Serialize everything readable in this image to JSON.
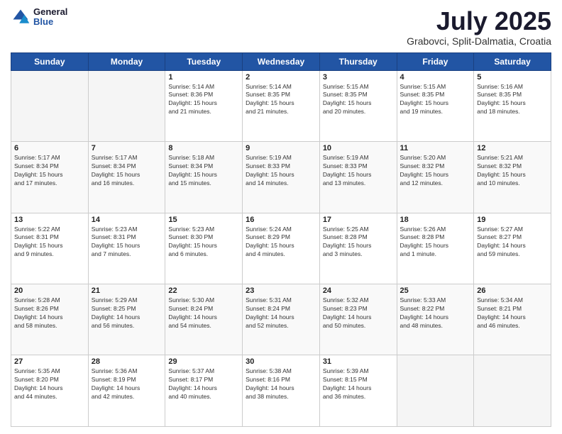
{
  "header": {
    "logo": {
      "general": "General",
      "blue": "Blue"
    },
    "title": "July 2025",
    "location": "Grabovci, Split-Dalmatia, Croatia"
  },
  "weekdays": [
    "Sunday",
    "Monday",
    "Tuesday",
    "Wednesday",
    "Thursday",
    "Friday",
    "Saturday"
  ],
  "weeks": [
    [
      {
        "day": "",
        "info": ""
      },
      {
        "day": "",
        "info": ""
      },
      {
        "day": "1",
        "info": "Sunrise: 5:14 AM\nSunset: 8:36 PM\nDaylight: 15 hours\nand 21 minutes."
      },
      {
        "day": "2",
        "info": "Sunrise: 5:14 AM\nSunset: 8:35 PM\nDaylight: 15 hours\nand 21 minutes."
      },
      {
        "day": "3",
        "info": "Sunrise: 5:15 AM\nSunset: 8:35 PM\nDaylight: 15 hours\nand 20 minutes."
      },
      {
        "day": "4",
        "info": "Sunrise: 5:15 AM\nSunset: 8:35 PM\nDaylight: 15 hours\nand 19 minutes."
      },
      {
        "day": "5",
        "info": "Sunrise: 5:16 AM\nSunset: 8:35 PM\nDaylight: 15 hours\nand 18 minutes."
      }
    ],
    [
      {
        "day": "6",
        "info": "Sunrise: 5:17 AM\nSunset: 8:34 PM\nDaylight: 15 hours\nand 17 minutes."
      },
      {
        "day": "7",
        "info": "Sunrise: 5:17 AM\nSunset: 8:34 PM\nDaylight: 15 hours\nand 16 minutes."
      },
      {
        "day": "8",
        "info": "Sunrise: 5:18 AM\nSunset: 8:34 PM\nDaylight: 15 hours\nand 15 minutes."
      },
      {
        "day": "9",
        "info": "Sunrise: 5:19 AM\nSunset: 8:33 PM\nDaylight: 15 hours\nand 14 minutes."
      },
      {
        "day": "10",
        "info": "Sunrise: 5:19 AM\nSunset: 8:33 PM\nDaylight: 15 hours\nand 13 minutes."
      },
      {
        "day": "11",
        "info": "Sunrise: 5:20 AM\nSunset: 8:32 PM\nDaylight: 15 hours\nand 12 minutes."
      },
      {
        "day": "12",
        "info": "Sunrise: 5:21 AM\nSunset: 8:32 PM\nDaylight: 15 hours\nand 10 minutes."
      }
    ],
    [
      {
        "day": "13",
        "info": "Sunrise: 5:22 AM\nSunset: 8:31 PM\nDaylight: 15 hours\nand 9 minutes."
      },
      {
        "day": "14",
        "info": "Sunrise: 5:23 AM\nSunset: 8:31 PM\nDaylight: 15 hours\nand 7 minutes."
      },
      {
        "day": "15",
        "info": "Sunrise: 5:23 AM\nSunset: 8:30 PM\nDaylight: 15 hours\nand 6 minutes."
      },
      {
        "day": "16",
        "info": "Sunrise: 5:24 AM\nSunset: 8:29 PM\nDaylight: 15 hours\nand 4 minutes."
      },
      {
        "day": "17",
        "info": "Sunrise: 5:25 AM\nSunset: 8:28 PM\nDaylight: 15 hours\nand 3 minutes."
      },
      {
        "day": "18",
        "info": "Sunrise: 5:26 AM\nSunset: 8:28 PM\nDaylight: 15 hours\nand 1 minute."
      },
      {
        "day": "19",
        "info": "Sunrise: 5:27 AM\nSunset: 8:27 PM\nDaylight: 14 hours\nand 59 minutes."
      }
    ],
    [
      {
        "day": "20",
        "info": "Sunrise: 5:28 AM\nSunset: 8:26 PM\nDaylight: 14 hours\nand 58 minutes."
      },
      {
        "day": "21",
        "info": "Sunrise: 5:29 AM\nSunset: 8:25 PM\nDaylight: 14 hours\nand 56 minutes."
      },
      {
        "day": "22",
        "info": "Sunrise: 5:30 AM\nSunset: 8:24 PM\nDaylight: 14 hours\nand 54 minutes."
      },
      {
        "day": "23",
        "info": "Sunrise: 5:31 AM\nSunset: 8:24 PM\nDaylight: 14 hours\nand 52 minutes."
      },
      {
        "day": "24",
        "info": "Sunrise: 5:32 AM\nSunset: 8:23 PM\nDaylight: 14 hours\nand 50 minutes."
      },
      {
        "day": "25",
        "info": "Sunrise: 5:33 AM\nSunset: 8:22 PM\nDaylight: 14 hours\nand 48 minutes."
      },
      {
        "day": "26",
        "info": "Sunrise: 5:34 AM\nSunset: 8:21 PM\nDaylight: 14 hours\nand 46 minutes."
      }
    ],
    [
      {
        "day": "27",
        "info": "Sunrise: 5:35 AM\nSunset: 8:20 PM\nDaylight: 14 hours\nand 44 minutes."
      },
      {
        "day": "28",
        "info": "Sunrise: 5:36 AM\nSunset: 8:19 PM\nDaylight: 14 hours\nand 42 minutes."
      },
      {
        "day": "29",
        "info": "Sunrise: 5:37 AM\nSunset: 8:17 PM\nDaylight: 14 hours\nand 40 minutes."
      },
      {
        "day": "30",
        "info": "Sunrise: 5:38 AM\nSunset: 8:16 PM\nDaylight: 14 hours\nand 38 minutes."
      },
      {
        "day": "31",
        "info": "Sunrise: 5:39 AM\nSunset: 8:15 PM\nDaylight: 14 hours\nand 36 minutes."
      },
      {
        "day": "",
        "info": ""
      },
      {
        "day": "",
        "info": ""
      }
    ]
  ]
}
